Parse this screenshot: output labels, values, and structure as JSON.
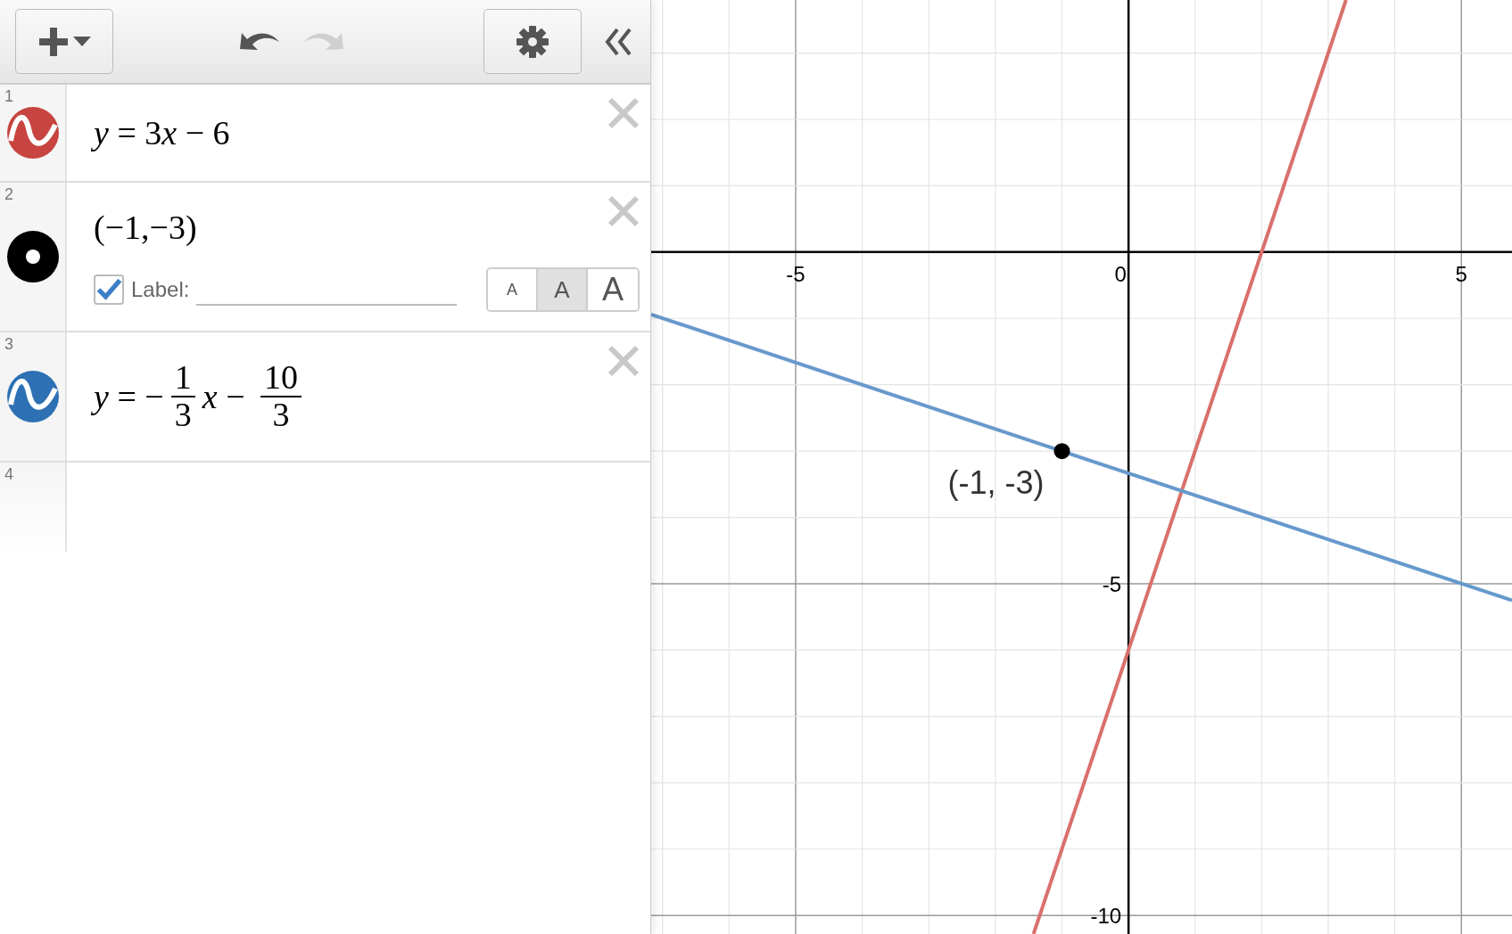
{
  "toolbar": {
    "undo": {
      "disabled": false
    },
    "redo": {
      "disabled": true
    }
  },
  "expressions": [
    {
      "kind": "curve",
      "number": "1",
      "color": "#c74440",
      "parts": [
        {
          "kind": "var",
          "text": "y"
        },
        {
          "kind": "text",
          "text": " = 3"
        },
        {
          "kind": "var",
          "text": "x"
        },
        {
          "kind": "text",
          "text": " − 6"
        }
      ]
    },
    {
      "kind": "point",
      "number": "2",
      "color": "#000000",
      "parts": [
        {
          "kind": "text",
          "text": "(−1,−3)"
        }
      ],
      "label": {
        "checked": true,
        "text": "Label:"
      },
      "sizes": [
        {
          "label": "A",
          "kind": "small",
          "selected": false
        },
        {
          "label": "A",
          "kind": "medium",
          "selected": true
        },
        {
          "label": "A",
          "kind": "large",
          "selected": false
        }
      ]
    },
    {
      "kind": "curve",
      "number": "3",
      "color": "#2d70b3",
      "parts": [
        {
          "kind": "var",
          "text": "y"
        },
        {
          "kind": "text",
          "text": " = −"
        },
        {
          "kind": "frac",
          "num": "1",
          "den": "3"
        },
        {
          "kind": "var",
          "text": "x"
        },
        {
          "kind": "text",
          "text": " − "
        },
        {
          "kind": "frac",
          "num": "10",
          "den": "3"
        }
      ]
    },
    {
      "kind": "empty",
      "number": "4"
    }
  ],
  "graph": {
    "chart_data": {
      "type": "line",
      "x": [
        -7.17,
        -1.427,
        3.267,
        5.76
      ],
      "series": [
        {
          "color": "#d9706b",
          "values": [
            null,
            -10.28,
            3.8,
            null
          ]
        },
        {
          "color": "#6699cc",
          "values": [
            -0.94,
            -2.86,
            -4.42,
            -5.25
          ]
        }
      ],
      "xlim": [
        -7.17,
        5.76
      ],
      "ylim": [
        -10.28,
        3.8
      ],
      "xticks": [
        -5,
        0,
        5
      ],
      "yticks": [
        -5,
        -10
      ],
      "grid": true,
      "annotations": [
        {
          "x": -1,
          "y": -3,
          "text": "(-1, -3)"
        }
      ]
    }
  }
}
